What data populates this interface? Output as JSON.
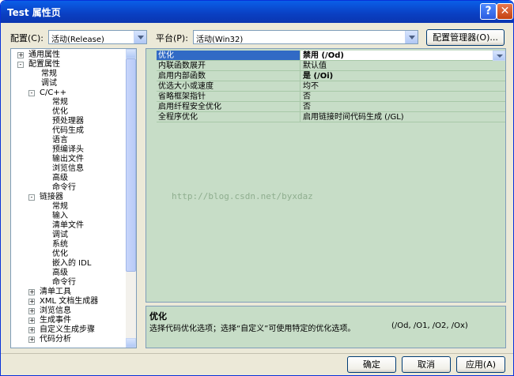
{
  "window": {
    "title": "Test 属性页"
  },
  "toolbar": {
    "config_label": "配置(C):",
    "config_value": "活动(Release)",
    "platform_label": "平台(P):",
    "platform_value": "活动(Win32)",
    "config_manager_label": "配置管理器(O)..."
  },
  "tree": {
    "items": [
      {
        "label": "通用属性",
        "expander": "+"
      },
      {
        "label": "配置属性",
        "expander": "-"
      },
      {
        "label": "常规",
        "expander": ""
      },
      {
        "label": "调试",
        "expander": ""
      },
      {
        "label": "C/C++",
        "expander": "-"
      },
      {
        "label": "常规",
        "expander": ""
      },
      {
        "label": "优化",
        "expander": ""
      },
      {
        "label": "预处理器",
        "expander": ""
      },
      {
        "label": "代码生成",
        "expander": ""
      },
      {
        "label": "语言",
        "expander": ""
      },
      {
        "label": "预编译头",
        "expander": ""
      },
      {
        "label": "输出文件",
        "expander": ""
      },
      {
        "label": "浏览信息",
        "expander": ""
      },
      {
        "label": "高级",
        "expander": ""
      },
      {
        "label": "命令行",
        "expander": ""
      },
      {
        "label": "链接器",
        "expander": "-"
      },
      {
        "label": "常规",
        "expander": ""
      },
      {
        "label": "输入",
        "expander": ""
      },
      {
        "label": "清单文件",
        "expander": ""
      },
      {
        "label": "调试",
        "expander": ""
      },
      {
        "label": "系统",
        "expander": ""
      },
      {
        "label": "优化",
        "expander": ""
      },
      {
        "label": "嵌入的 IDL",
        "expander": ""
      },
      {
        "label": "高级",
        "expander": ""
      },
      {
        "label": "命令行",
        "expander": ""
      },
      {
        "label": "清单工具",
        "expander": "+"
      },
      {
        "label": "XML 文档生成器",
        "expander": "+"
      },
      {
        "label": "浏览信息",
        "expander": "+"
      },
      {
        "label": "生成事件",
        "expander": "+"
      },
      {
        "label": "自定义生成步骤",
        "expander": "+"
      },
      {
        "label": "代码分析",
        "expander": "+"
      }
    ]
  },
  "grid": {
    "rows": [
      {
        "label": "优化",
        "value": "禁用 (/Od)"
      },
      {
        "label": "内联函数展开",
        "value": "默认值"
      },
      {
        "label": "启用内部函数",
        "value": "是 (/Oi)"
      },
      {
        "label": "优选大小或速度",
        "value": "均不"
      },
      {
        "label": "省略框架指针",
        "value": "否"
      },
      {
        "label": "启用纤程安全优化",
        "value": "否"
      },
      {
        "label": "全程序优化",
        "value": "启用链接时间代码生成 (/GL)"
      }
    ]
  },
  "watermark": "http://blog.csdn.net/byxdaz",
  "description": {
    "title": "优化",
    "text": "选择代码优化选项；选择“自定义”可使用特定的优化选项。",
    "options": "(/Od, /O1, /O2, /Ox)"
  },
  "buttons": {
    "ok": "确定",
    "cancel": "取消",
    "apply": "应用(A)"
  }
}
